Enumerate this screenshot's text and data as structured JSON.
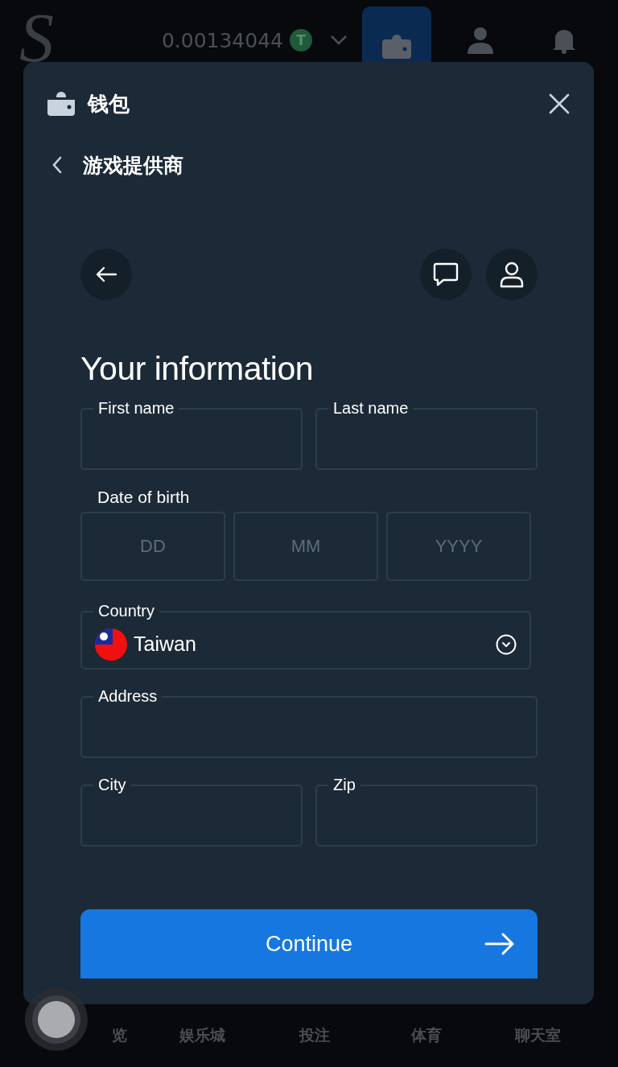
{
  "topbar": {
    "logo": "S",
    "balance": "0.00134044",
    "currency_symbol": "T",
    "tabs": [
      {
        "kind": "wallet",
        "selected": true
      },
      {
        "kind": "user",
        "selected": false
      },
      {
        "kind": "bell",
        "selected": false
      }
    ]
  },
  "modal": {
    "title": "钱包",
    "breadcrumb": "游戏提供商",
    "form": {
      "title": "Your information",
      "rows": [
        {
          "kind": "pair",
          "fields": [
            {
              "label": "First name"
            },
            {
              "label": "Last name"
            }
          ]
        },
        {
          "kind": "date",
          "label": "Date of birth",
          "parts": [
            {
              "placeholder": "DD"
            },
            {
              "placeholder": "MM"
            },
            {
              "placeholder": "YYYY"
            }
          ]
        },
        {
          "kind": "select",
          "label": "Country",
          "value": "Taiwan"
        },
        {
          "kind": "single",
          "fields": [
            {
              "label": "Address"
            }
          ]
        },
        {
          "kind": "pair",
          "fields": [
            {
              "label": "City"
            },
            {
              "label": "Zip"
            }
          ]
        }
      ],
      "button": "Continue"
    }
  },
  "bottom_nav": [
    {
      "label": "览"
    },
    {
      "label": "娱乐城"
    },
    {
      "label": "投注"
    },
    {
      "label": "体育"
    },
    {
      "label": "聊天室"
    }
  ]
}
